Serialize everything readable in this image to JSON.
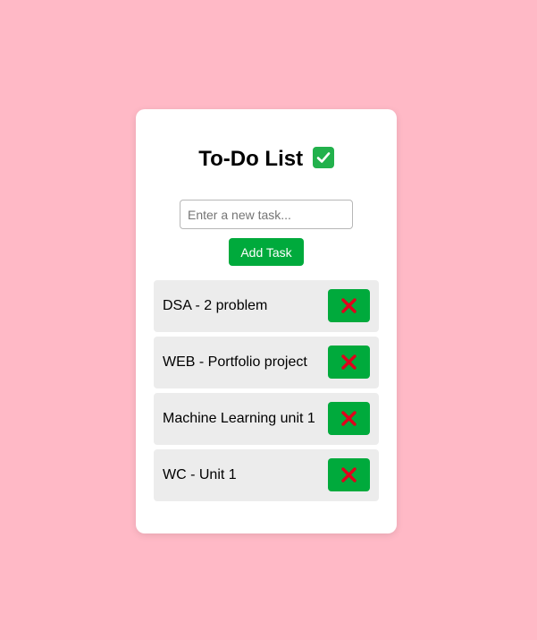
{
  "app": {
    "title": "To-Do List",
    "title_icon": "check-mark-button-icon"
  },
  "input": {
    "placeholder": "Enter a new task...",
    "value": ""
  },
  "add_button": {
    "label": "Add Task"
  },
  "tasks": [
    {
      "text": "DSA - 2 problem",
      "delete_icon": "cross-mark-icon"
    },
    {
      "text": "WEB - Portfolio project",
      "delete_icon": "cross-mark-icon"
    },
    {
      "text": "Machine Learning unit 1",
      "delete_icon": "cross-mark-icon"
    },
    {
      "text": "WC - Unit 1",
      "delete_icon": "cross-mark-icon"
    }
  ],
  "colors": {
    "background": "#ffb9c6",
    "card": "#ffffff",
    "accent_green": "#00aa3c",
    "task_bg": "#ececec",
    "cross_red": "#e0001b"
  }
}
